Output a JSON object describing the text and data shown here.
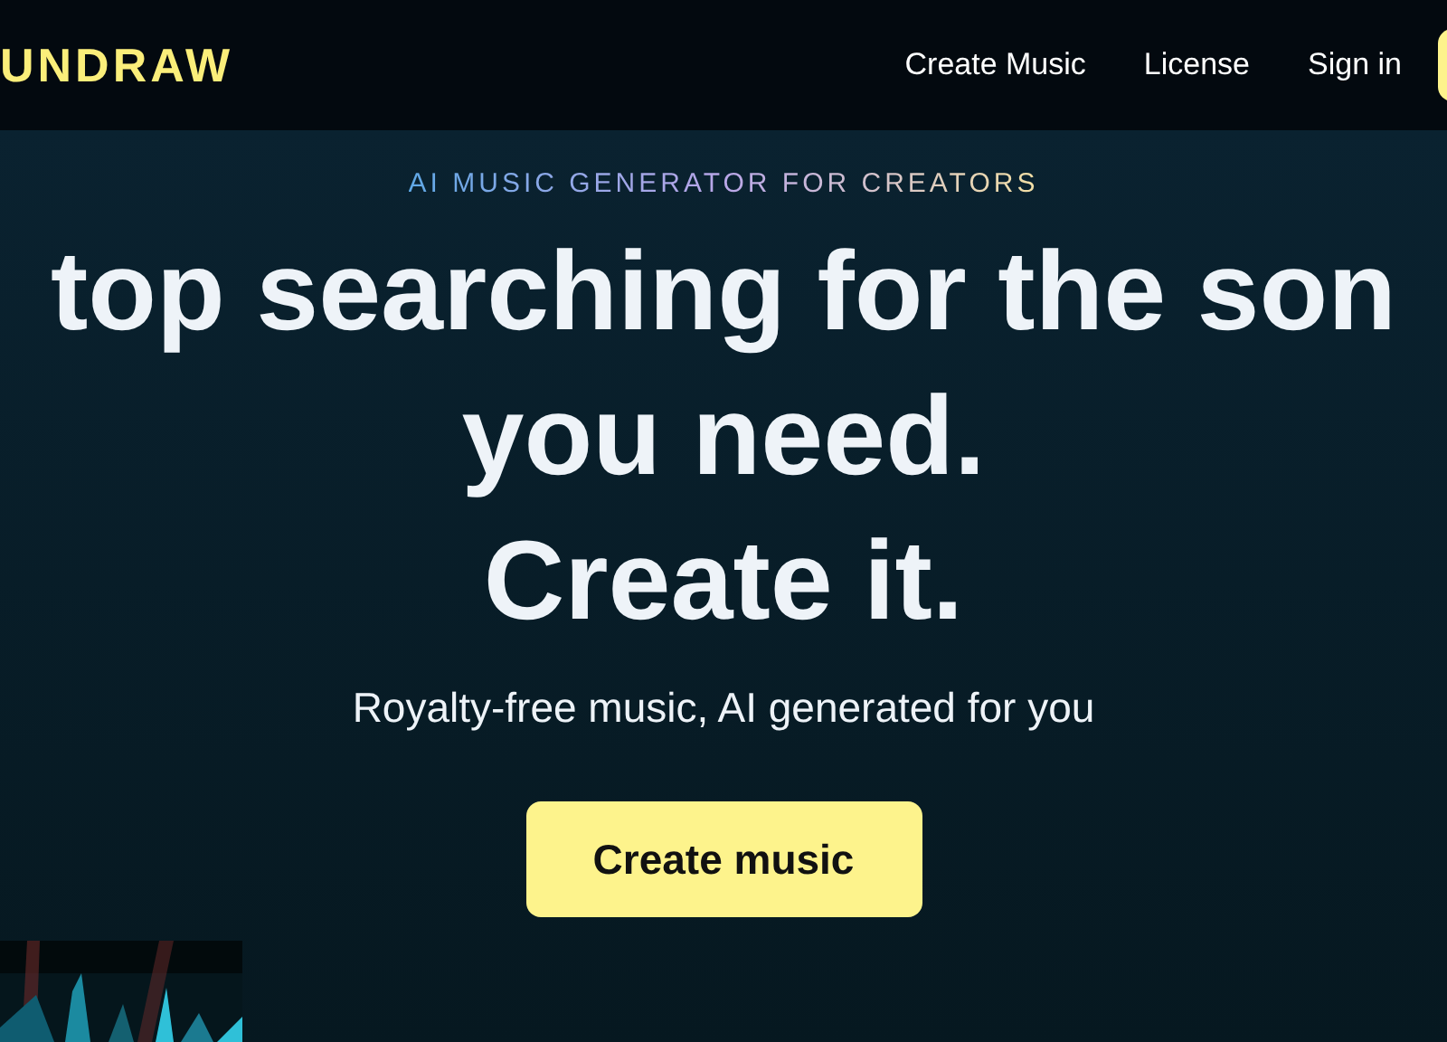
{
  "nav": {
    "logo": "UNDRAW",
    "links": [
      "Create Music",
      "License",
      "Sign in"
    ]
  },
  "hero": {
    "eyebrow": "AI MUSIC GENERATOR FOR CREATORS",
    "headline": [
      "top searching for the son",
      "you need.",
      "Create it."
    ],
    "subtitle": "Royalty-free music, AI generated for you",
    "button": "Create music"
  }
}
